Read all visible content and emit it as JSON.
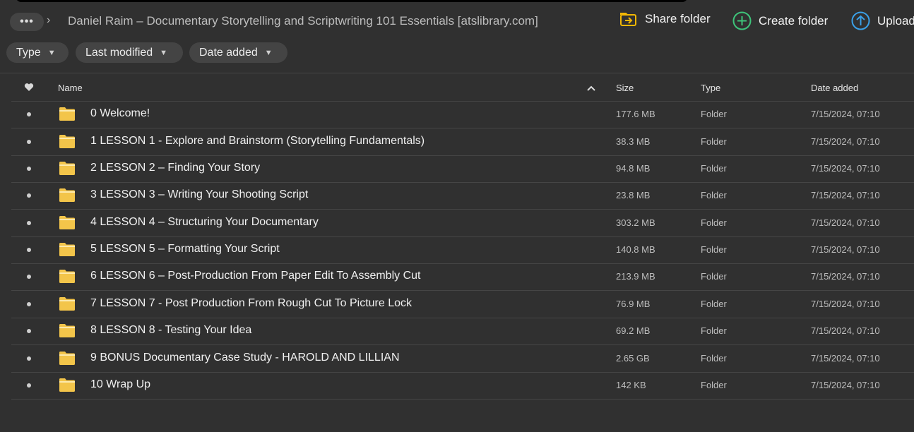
{
  "header": {
    "more_label": "•••",
    "breadcrumb_title": "Daniel Raim – Documentary Storytelling and Scriptwriting 101 Essentials [atslibrary.com]",
    "share_label": "Share folder",
    "create_label": "Create folder",
    "upload_label": "Upload"
  },
  "filters": {
    "type": "Type",
    "last_modified": "Last modified",
    "date_added": "Date added"
  },
  "table": {
    "col_name": "Name",
    "col_size": "Size",
    "col_type": "Type",
    "col_date": "Date added",
    "rows": [
      {
        "name": "0 Welcome!",
        "size": "177.6 MB",
        "type": "Folder",
        "date": "7/15/2024, 07:10"
      },
      {
        "name": "1 LESSON 1 - Explore and Brainstorm (Storytelling Fundamentals)",
        "size": "38.3 MB",
        "type": "Folder",
        "date": "7/15/2024, 07:10"
      },
      {
        "name": "2 LESSON 2 – Finding Your Story",
        "size": "94.8 MB",
        "type": "Folder",
        "date": "7/15/2024, 07:10"
      },
      {
        "name": "3 LESSON 3 – Writing Your Shooting Script",
        "size": "23.8 MB",
        "type": "Folder",
        "date": "7/15/2024, 07:10"
      },
      {
        "name": "4 LESSON 4 – Structuring Your Documentary",
        "size": "303.2 MB",
        "type": "Folder",
        "date": "7/15/2024, 07:10"
      },
      {
        "name": "5 LESSON 5 – Formatting Your Script",
        "size": "140.8 MB",
        "type": "Folder",
        "date": "7/15/2024, 07:10"
      },
      {
        "name": "6 LESSON 6 – Post-Production From Paper Edit To Assembly Cut",
        "size": "213.9 MB",
        "type": "Folder",
        "date": "7/15/2024, 07:10"
      },
      {
        "name": "7 LESSON 7 - Post Production From Rough Cut To Picture Lock",
        "size": "76.9 MB",
        "type": "Folder",
        "date": "7/15/2024, 07:10"
      },
      {
        "name": "8 LESSON 8 - Testing Your Idea",
        "size": "69.2 MB",
        "type": "Folder",
        "date": "7/15/2024, 07:10"
      },
      {
        "name": "9 BONUS Documentary Case Study - HAROLD AND LILLIAN",
        "size": "2.65 GB",
        "type": "Folder",
        "date": "7/15/2024, 07:10"
      },
      {
        "name": "10 Wrap Up",
        "size": "142 KB",
        "type": "Folder",
        "date": "7/15/2024, 07:10"
      }
    ]
  },
  "colors": {
    "background": "#303030",
    "folder_yellow": "#f3c54a",
    "share_accent": "#f2b705",
    "create_accent": "#3ec47a",
    "upload_accent": "#3aa0e8"
  },
  "icons": {
    "more": "ellipsis-icon",
    "breadcrumb_sep": "chevron-right-icon",
    "share": "share-folder-icon",
    "create": "plus-circle-icon",
    "upload": "upload-arrow-icon",
    "favorite": "heart-icon",
    "sort": "chevron-up-icon",
    "row": "folder-icon"
  }
}
